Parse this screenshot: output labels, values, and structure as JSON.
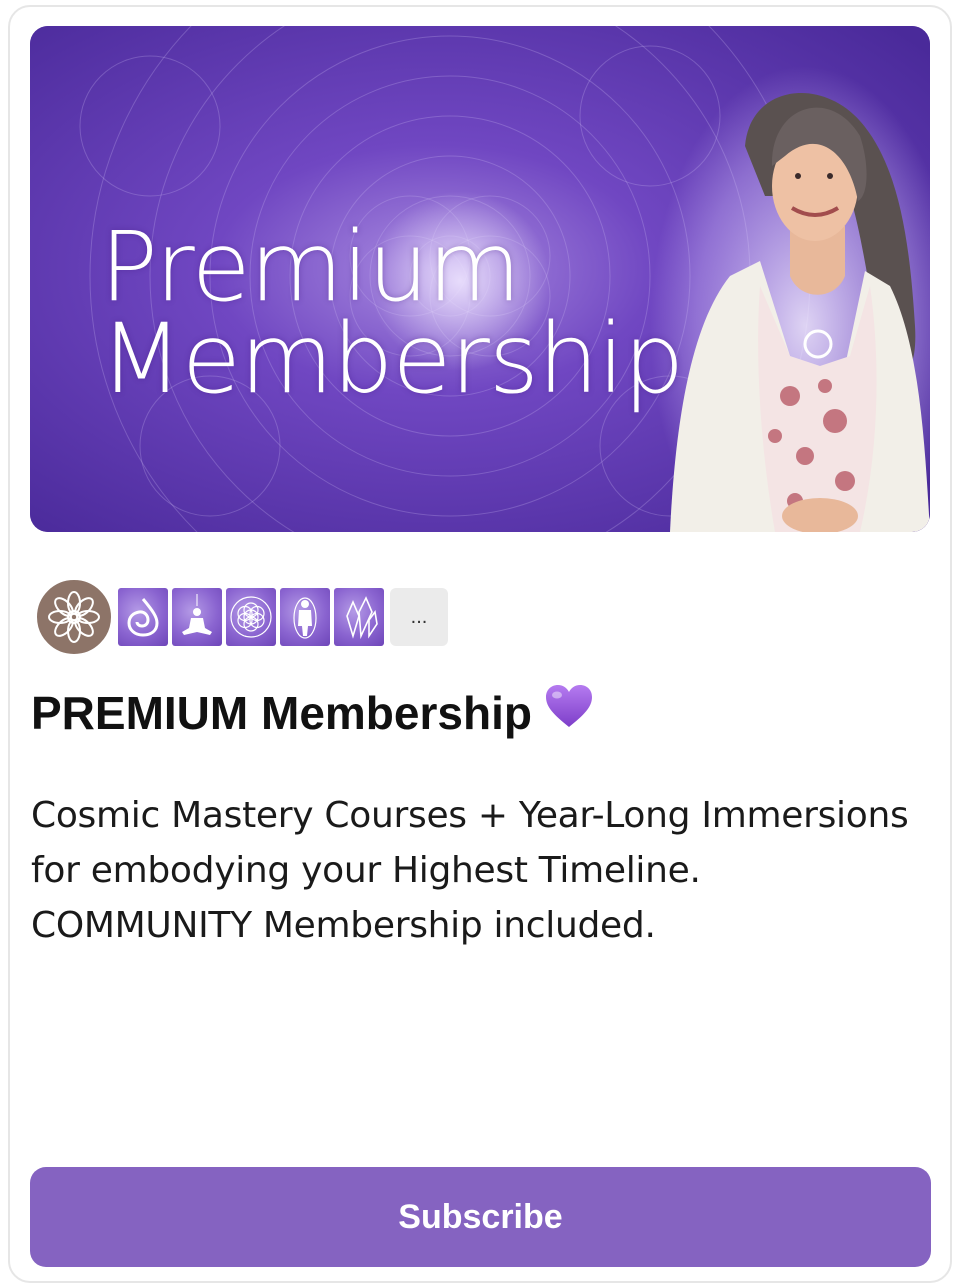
{
  "banner": {
    "line1": "Premium",
    "line2": "Membership"
  },
  "course_icons": [
    {
      "icon": "lotus-icon"
    },
    {
      "icon": "spiral-icon"
    },
    {
      "icon": "meditation-icon"
    },
    {
      "icon": "flower-of-life-icon"
    },
    {
      "icon": "figure-icon"
    },
    {
      "icon": "crystal-icon"
    }
  ],
  "more_label": "...",
  "title": "PREMIUM Membership",
  "title_emoji": "purple-heart-icon",
  "description": "Cosmic Mastery Courses + Year-Long Immersions for embodying your Highest Timeline. COMMUNITY Membership included.",
  "subscribe_label": "Subscribe",
  "colors": {
    "accent": "#8563c1",
    "banner": "#5b36a8",
    "avatar": "#8d7468",
    "heart": "#9b59d6"
  }
}
